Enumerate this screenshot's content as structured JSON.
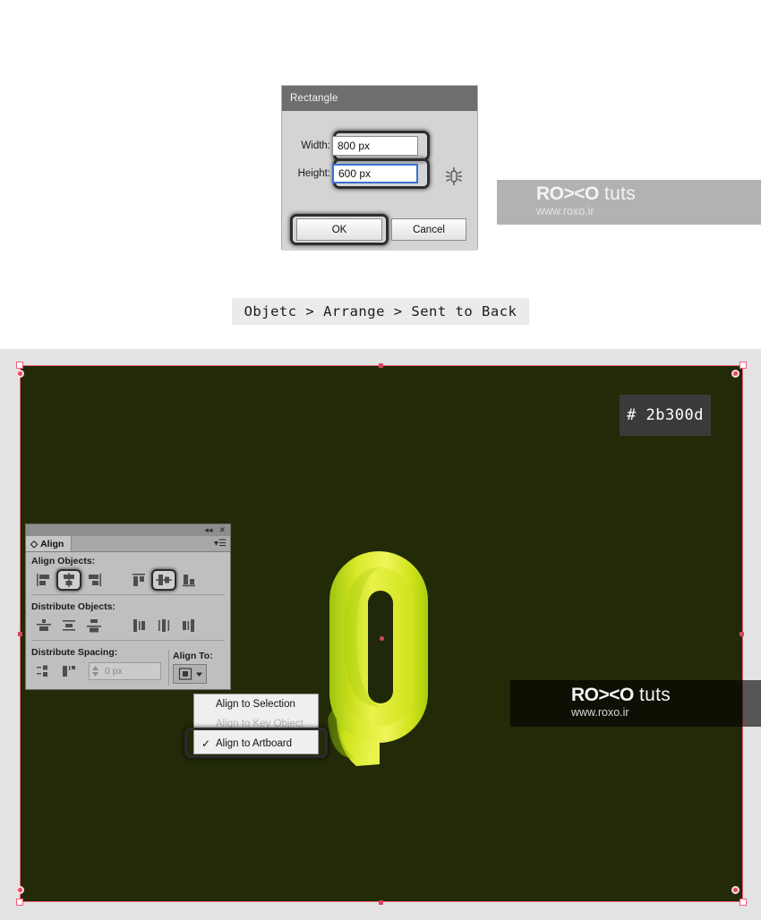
{
  "dialog": {
    "title": "Rectangle",
    "width_label": "Width:",
    "width_value": "800 px",
    "height_label": "Height:",
    "height_value": "600 px",
    "constrain_icon": "broken-chain-icon",
    "ok_label": "OK",
    "cancel_label": "Cancel"
  },
  "watermark": {
    "brand_bold": "RO><O",
    "brand_light": " tuts",
    "url": "www.roxo.ir"
  },
  "instruction": {
    "text": "Objetc > Arrange > Sent to Back"
  },
  "artboard": {
    "hex_badge": "# 2b300d",
    "background_color": "#2b300d",
    "selection_color": "#f0607a",
    "artwork_colors": {
      "light": "#e8f24a",
      "mid": "#c6dd18",
      "dark": "#86b80a",
      "shadow": "#5a8c06"
    }
  },
  "align_panel": {
    "tab_label": "Align",
    "collapse_icon": "collapse-double-arrow-icon",
    "close_icon": "close-icon",
    "menu_icon": "panel-menu-icon",
    "sections": [
      {
        "title": "Align Objects:",
        "buttons": [
          {
            "name": "align-left-edges",
            "selected": false
          },
          {
            "name": "align-horizontal-center",
            "selected": true
          },
          {
            "name": "align-right-edges",
            "selected": false
          },
          {
            "name": "align-top-edges",
            "selected": false
          },
          {
            "name": "align-vertical-center",
            "selected": true
          },
          {
            "name": "align-bottom-edges",
            "selected": false
          }
        ]
      },
      {
        "title": "Distribute Objects:",
        "buttons": [
          {
            "name": "distribute-vertical-top",
            "selected": false
          },
          {
            "name": "distribute-vertical-center",
            "selected": false
          },
          {
            "name": "distribute-vertical-bottom",
            "selected": false
          },
          {
            "name": "distribute-horizontal-left",
            "selected": false
          },
          {
            "name": "distribute-horizontal-center",
            "selected": false
          },
          {
            "name": "distribute-horizontal-right",
            "selected": false
          }
        ]
      }
    ],
    "spacing_title": "Distribute Spacing:",
    "spacing_value": "0 px",
    "align_to_label": "Align To:",
    "align_to_value": "Align to Artboard"
  },
  "align_menu": {
    "items": [
      {
        "label": "Align to Selection",
        "checked": false,
        "disabled": false
      },
      {
        "label": "Align to Key Object",
        "checked": false,
        "disabled": true
      },
      {
        "label": "Align to Artboard",
        "checked": true,
        "disabled": false
      }
    ],
    "check_glyph": "✓"
  }
}
